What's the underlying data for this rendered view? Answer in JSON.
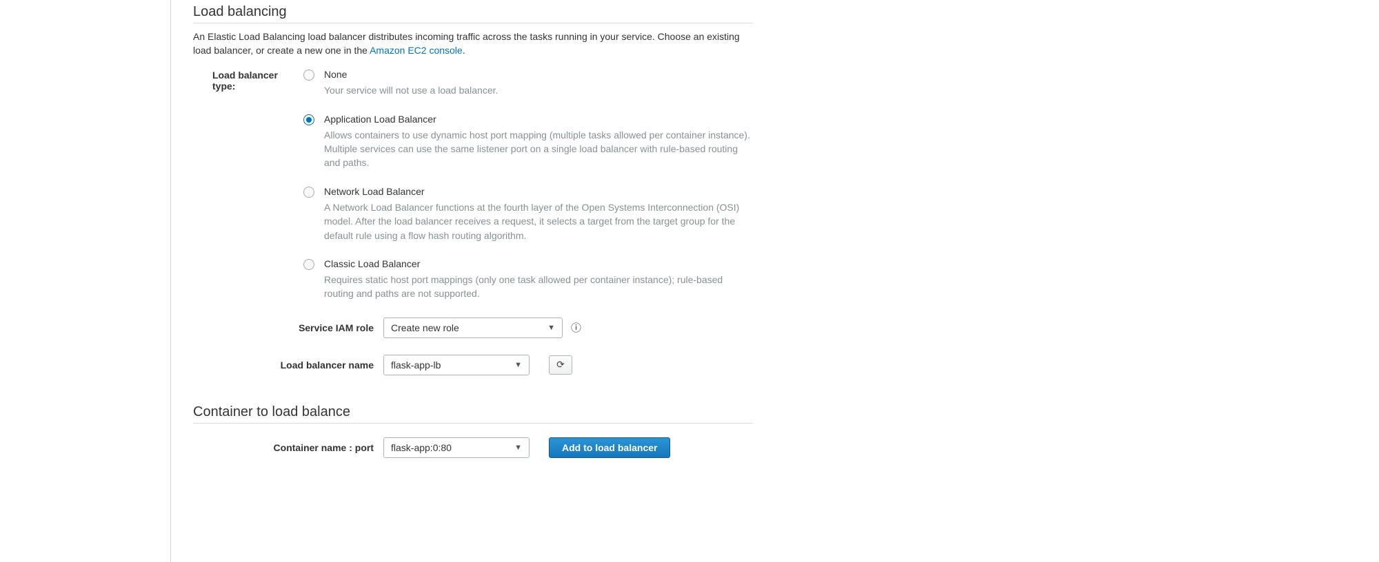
{
  "section1": {
    "title": "Load balancing",
    "desc_prefix": "An Elastic Load Balancing load balancer distributes incoming traffic across the tasks running in your service. Choose an existing load balancer, or create a new one in the ",
    "desc_link": "Amazon EC2 console",
    "desc_suffix": ".",
    "type_label": "Load balancer type:",
    "options": [
      {
        "title": "None",
        "desc": "Your service will not use a load balancer."
      },
      {
        "title": "Application Load Balancer",
        "desc": "Allows containers to use dynamic host port mapping (multiple tasks allowed per container instance). Multiple services can use the same listener port on a single load balancer with rule-based routing and paths."
      },
      {
        "title": "Network Load Balancer",
        "desc": "A Network Load Balancer functions at the fourth layer of the Open Systems Interconnection (OSI) model. After the load balancer receives a request, it selects a target from the target group for the default rule using a flow hash routing algorithm."
      },
      {
        "title": "Classic Load Balancer",
        "desc": "Requires static host port mappings (only one task allowed per container instance); rule-based routing and paths are not supported."
      }
    ],
    "selected_index": 1,
    "iam_label": "Service IAM role",
    "iam_value": "Create new role",
    "lbname_label": "Load balancer name",
    "lbname_value": "flask-app-lb"
  },
  "section2": {
    "title": "Container to load balance",
    "container_label": "Container name : port",
    "container_value": "flask-app:0:80",
    "add_btn": "Add to load balancer"
  }
}
